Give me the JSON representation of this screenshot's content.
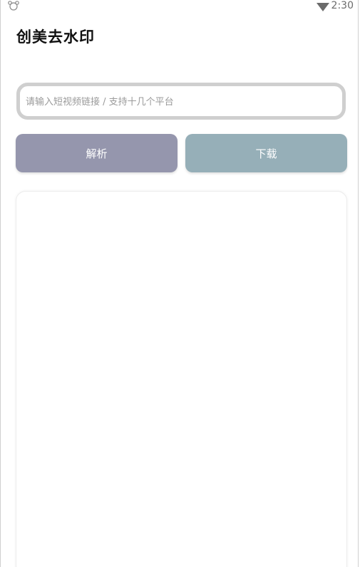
{
  "status_bar": {
    "left_icon": "app-notification-icon",
    "signal_icon": "wifi-icon",
    "time": "2:30"
  },
  "app": {
    "title": "创美去水印"
  },
  "input": {
    "value": "",
    "placeholder": "请输入短视频链接 / 支持十几个平台"
  },
  "buttons": {
    "parse_label": "解析",
    "download_label": "下载"
  },
  "colors": {
    "parse_button": "#9596ad",
    "download_button": "#96afb8",
    "input_border": "#cfcfcf"
  }
}
